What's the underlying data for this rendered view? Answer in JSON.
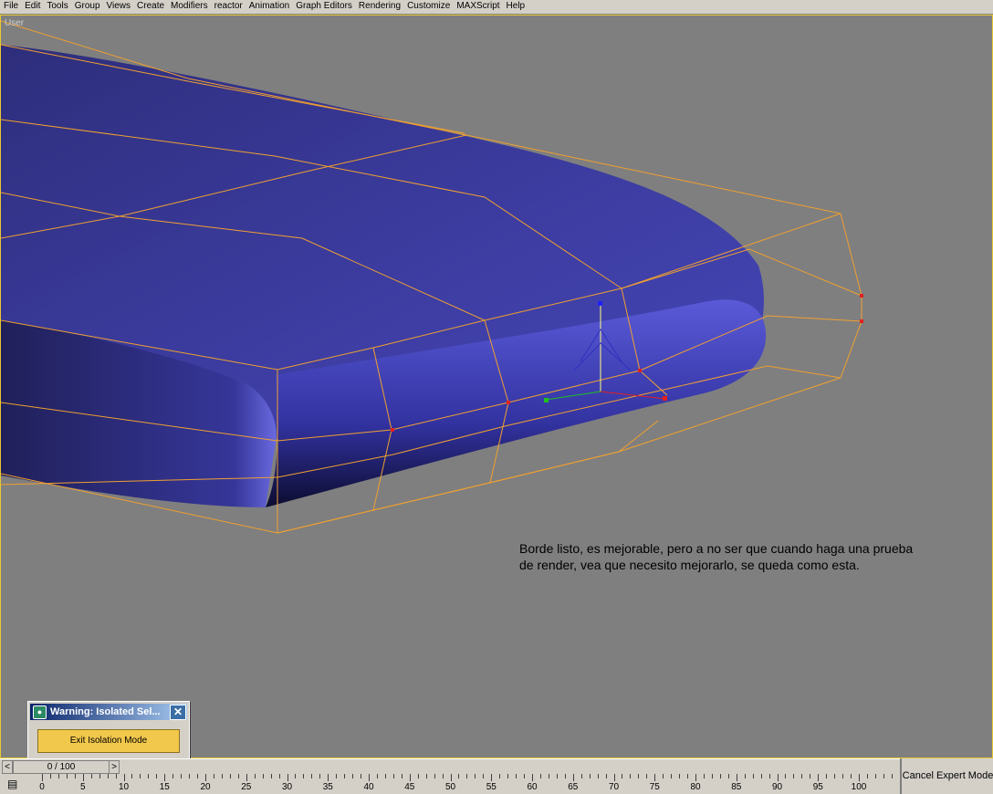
{
  "menu": [
    "File",
    "Edit",
    "Tools",
    "Group",
    "Views",
    "Create",
    "Modifiers",
    "reactor",
    "Animation",
    "Graph Editors",
    "Rendering",
    "Customize",
    "MAXScript",
    "Help"
  ],
  "viewport": {
    "label": "User",
    "note": "Borde listo, es mejorable, pero a no ser que cuando haga una prueba de render, vea que necesito mejorarlo, se queda como esta."
  },
  "dialog": {
    "title": "Warning: Isolated Sel...",
    "close_icon": "close-icon",
    "exit_button": "Exit Isolation Mode"
  },
  "timeline": {
    "frame_display": "0 / 100",
    "prev_icon": "<",
    "next_icon": ">",
    "ruler_labels": [
      "0",
      "5",
      "10",
      "15",
      "20",
      "25",
      "30",
      "35",
      "40",
      "45",
      "50",
      "55",
      "60",
      "65",
      "70",
      "75",
      "80",
      "85",
      "90",
      "95",
      "100"
    ]
  },
  "expert_mode_button": "Cancel Expert Mode",
  "colors": {
    "mesh": "#3a3a9c",
    "cage": "#f0a030",
    "viewport_bg": "#7f7f7f",
    "active_border": "#e8c832",
    "exit_button": "#f2c84c"
  }
}
